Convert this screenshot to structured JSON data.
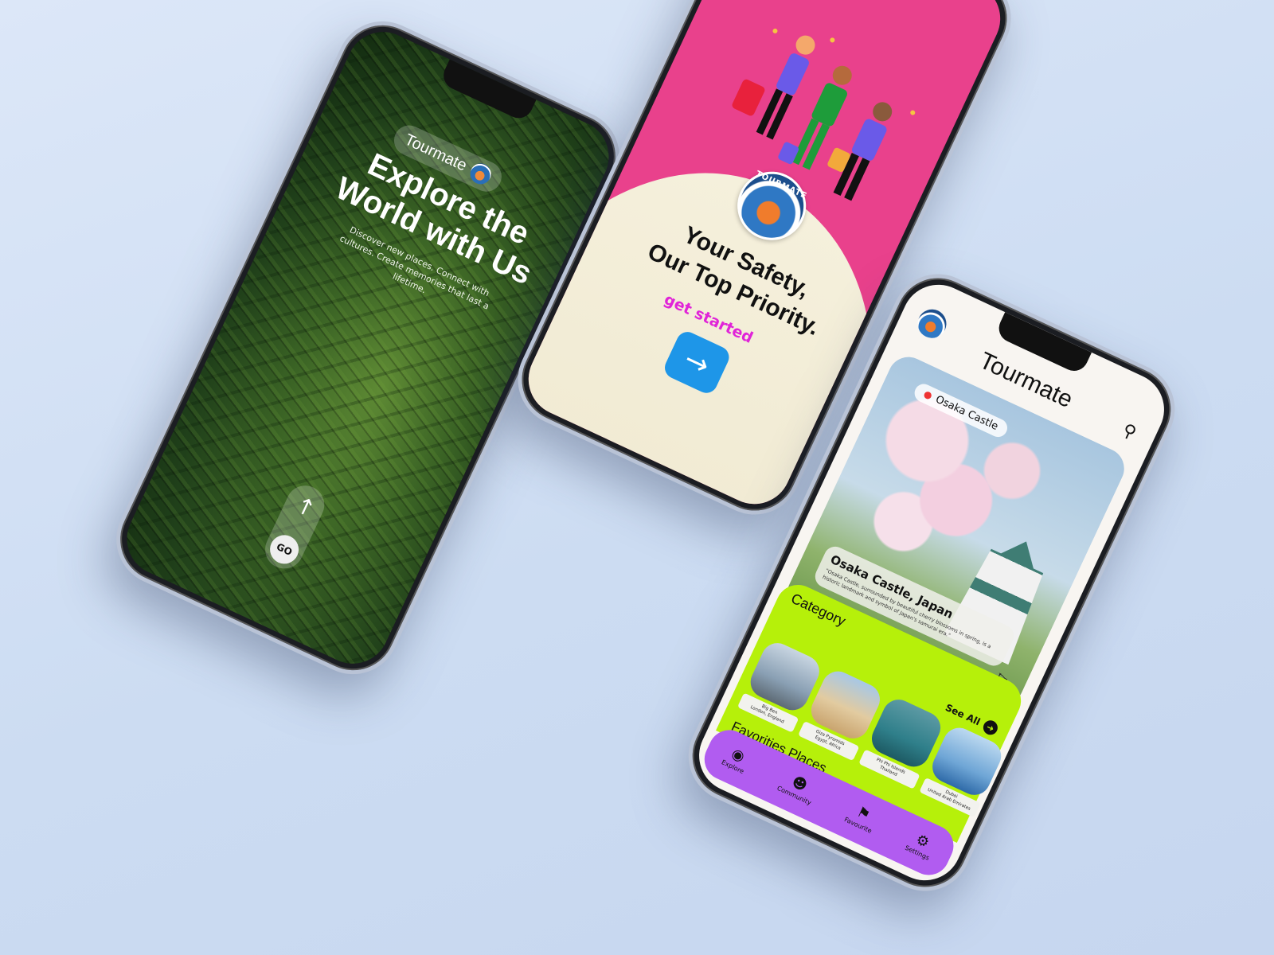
{
  "phone1": {
    "brand": "Tourmate",
    "title_line1": "Explore the",
    "title_line2": "World with Us",
    "subtitle": "Discover new places. Connect with cultures. Create memories that last a lifetime.",
    "go_label": "GO",
    "arrow_glyph": "↑"
  },
  "phone2": {
    "logo_text": "TOURMATE",
    "title_line1": "Your Safety,",
    "title_line2": "Our Top Priority.",
    "cta_text": "get started",
    "arrow_glyph": "→",
    "colors": {
      "background": "#e9418c",
      "cream": "#f5f0dc",
      "cta": "#e024d8",
      "button": "#1e96e8"
    }
  },
  "phone3": {
    "app_title": "Tourmate",
    "search_glyph": "⚲",
    "location_chip": "Osaka Castle",
    "hero_title": "Osaka Castle, Japan",
    "hero_description": "\"Osaka Castle, surrounded by beautiful cherry blossoms in spring, is a historic landmark and symbol of Japan's samurai era.\"",
    "category_heading": "Category",
    "see_all": "See All",
    "categories": [
      {
        "name": "Big Ben",
        "place": "London, England",
        "color": "#8aa0b4"
      },
      {
        "name": "Giza Pyramids",
        "place": "Egypt, Africa",
        "color": "#c9a46e"
      },
      {
        "name": "Phi Phi Islands",
        "place": "Thailand",
        "color": "#2f7f8a"
      },
      {
        "name": "Dubai",
        "place": "United Arab Emirates",
        "color": "#6fa6d6"
      }
    ],
    "favorites_heading": "Favorities Places",
    "explore_label": "explore",
    "nav": [
      {
        "label": "Explore",
        "icon": "globe-icon",
        "glyph": "◉"
      },
      {
        "label": "Community",
        "icon": "community-icon",
        "glyph": "☻"
      },
      {
        "label": "Favourite",
        "icon": "bookmark-icon",
        "glyph": "⚑"
      },
      {
        "label": "Settings",
        "icon": "gear-icon",
        "glyph": "⚙"
      }
    ],
    "colors": {
      "accent_lime": "#b6f00a",
      "nav_purple": "#b15cf0"
    }
  }
}
